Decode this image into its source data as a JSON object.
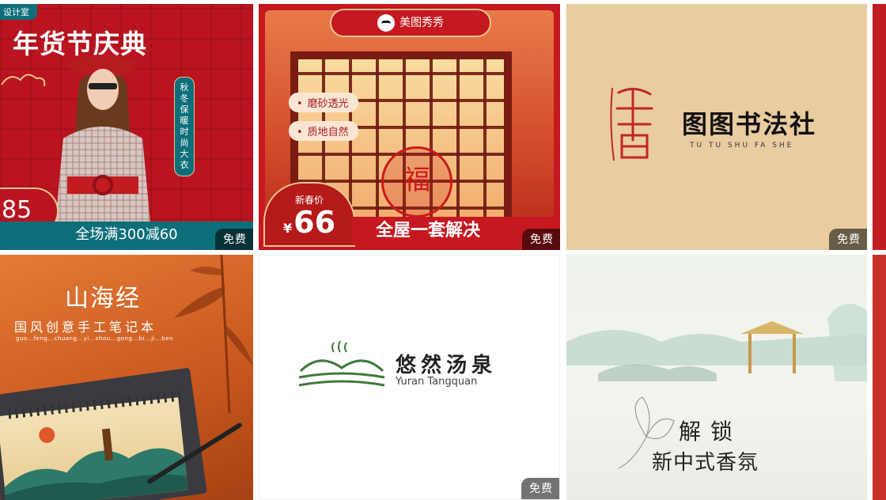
{
  "badge_label": "免费",
  "cards": [
    {
      "tag": "设计室",
      "title": "年货节庆典",
      "vertical_text": "秋冬保暖时尚大衣",
      "price": "85",
      "bottom_text": "全场满300减60",
      "badge": "免费"
    },
    {
      "brand": "美图秀秀",
      "features": [
        "磨砂透光",
        "质地自然"
      ],
      "price_label": "新春价",
      "currency": "¥",
      "price": "66",
      "slogan": "全屋一套解决",
      "badge": "免费"
    },
    {
      "logo_char": "書",
      "name": "图图书法社",
      "pinyin": "TU TU SHU FA SHE",
      "badge": "免费"
    },
    {
      "title": "山海经",
      "subtitle": "国风创意手工笔记本",
      "pinyin": "guo...feng...chuang...yi...shou...gong...bi...ji...ben"
    },
    {
      "name": "悠然汤泉",
      "english": "Yuran Tangquan",
      "badge": "免费"
    },
    {
      "line1": "解锁",
      "line2": "新中式香氛"
    }
  ]
}
